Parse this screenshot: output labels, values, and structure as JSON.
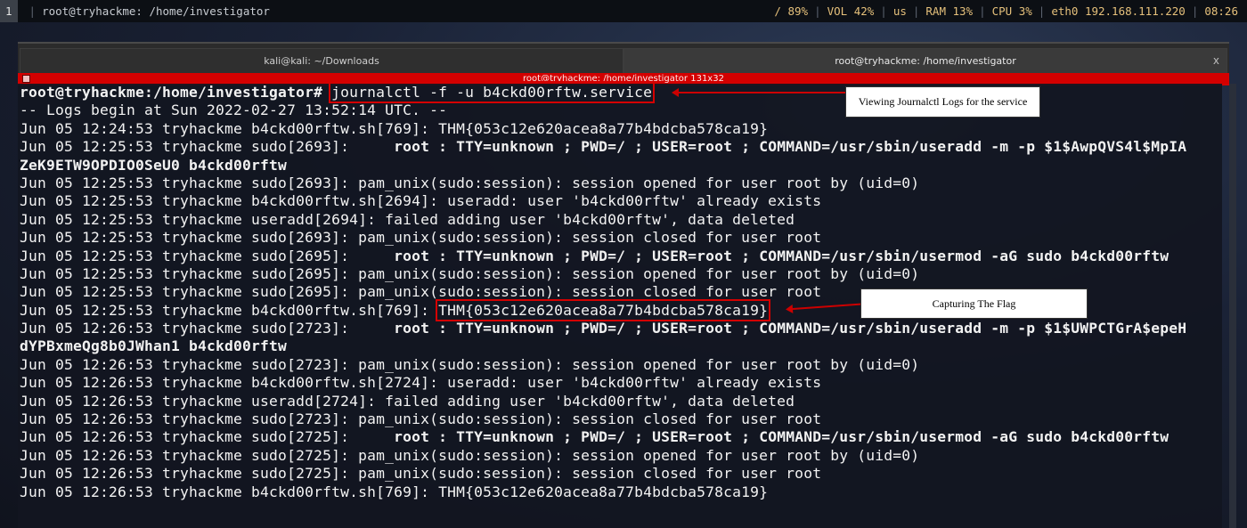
{
  "topbar": {
    "workspace": "1",
    "title": "root@tryhackme: /home/investigator",
    "disk": "/ 89%",
    "vol": "VOL 42%",
    "lang": "us",
    "ram": "RAM 13%",
    "cpu": "CPU  3%",
    "net": "eth0 192.168.111.220",
    "clock": "08:26"
  },
  "tabs": [
    {
      "label": "kali@kali: ~/Downloads"
    },
    {
      "label": "root@tryhackme: /home/investigator"
    }
  ],
  "tab_close": "x",
  "titlebar": "root@tryhackme: /home/investigator 131x32",
  "terminal": {
    "prompt": "root@tryhackme:/home/investigator# ",
    "command": "journalctl -f -u b4ckd00rftw.service",
    "lines": [
      "-- Logs begin at Sun 2022-02-27 13:52:14 UTC. --",
      "Jun 05 12:24:53 tryhackme b4ckd00rftw.sh[769]: THM{053c12e620acea8a77b4bdcba578ca19}",
      "Jun 05 12:25:53 tryhackme sudo[2693]:",
      "ZeK9ETW9OPDIO0SeU0 b4ckd00rftw",
      "Jun 05 12:25:53 tryhackme sudo[2693]: pam_unix(sudo:session): session opened for user root by (uid=0)",
      "Jun 05 12:25:53 tryhackme b4ckd00rftw.sh[2694]: useradd: user 'b4ckd00rftw' already exists",
      "Jun 05 12:25:53 tryhackme useradd[2694]: failed adding user 'b4ckd00rftw', data deleted",
      "Jun 05 12:25:53 tryhackme sudo[2693]: pam_unix(sudo:session): session closed for user root",
      "Jun 05 12:25:53 tryhackme sudo[2695]:",
      "Jun 05 12:25:53 tryhackme sudo[2695]: pam_unix(sudo:session): session opened for user root by (uid=0)",
      "Jun 05 12:25:53 tryhackme sudo[2695]: pam_unix(sudo:session): session closed for user root",
      "Jun 05 12:25:53 tryhackme b4ckd00rftw.sh[769]: ",
      "Jun 05 12:26:53 tryhackme sudo[2723]:",
      "dYPBxmeQg8b0JWhan1 b4ckd00rftw",
      "Jun 05 12:26:53 tryhackme sudo[2723]: pam_unix(sudo:session): session opened for user root by (uid=0)",
      "Jun 05 12:26:53 tryhackme b4ckd00rftw.sh[2724]: useradd: user 'b4ckd00rftw' already exists",
      "Jun 05 12:26:53 tryhackme useradd[2724]: failed adding user 'b4ckd00rftw', data deleted",
      "Jun 05 12:26:53 tryhackme sudo[2723]: pam_unix(sudo:session): session closed for user root",
      "Jun 05 12:26:53 tryhackme sudo[2725]:",
      "Jun 05 12:26:53 tryhackme sudo[2725]: pam_unix(sudo:session): session opened for user root by (uid=0)",
      "Jun 05 12:26:53 tryhackme sudo[2725]: pam_unix(sudo:session): session closed for user root",
      "Jun 05 12:26:53 tryhackme b4ckd00rftw.sh[769]: THM{053c12e620acea8a77b4bdcba578ca19}"
    ],
    "bold_cmds": {
      "l3": "     root : TTY=unknown ; PWD=/ ; USER=root ; COMMAND=/usr/sbin/useradd -m -p $1$AwpQVS4l$MpIA",
      "l9": "     root : TTY=unknown ; PWD=/ ; USER=root ; COMMAND=/usr/sbin/usermod -aG sudo b4ckd00rftw",
      "l13": "     root : TTY=unknown ; PWD=/ ; USER=root ; COMMAND=/usr/sbin/useradd -m -p $1$UWPCTGrA$epeH",
      "l19": "     root : TTY=unknown ; PWD=/ ; USER=root ; COMMAND=/usr/sbin/usermod -aG sudo b4ckd00rftw"
    },
    "flag": "THM{053c12e620acea8a77b4bdcba578ca19}"
  },
  "annotations": {
    "journal": "Viewing Journalctl Logs for the service",
    "flag": "Capturing The Flag"
  },
  "colors": {
    "accent_red": "#d40000",
    "status_yellow": "#e5c07b"
  }
}
